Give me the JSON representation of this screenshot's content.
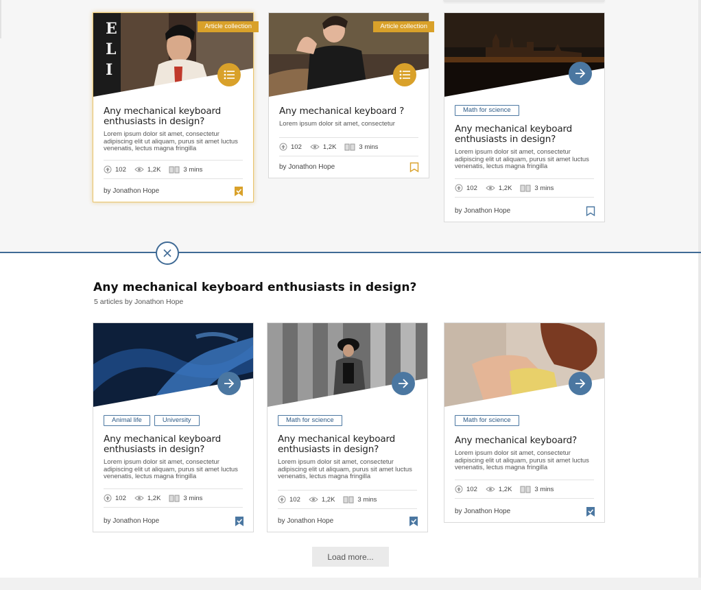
{
  "top_cards": [
    {
      "ribbon": "Article collection",
      "title": "Any mechanical keyboard enthusiasts in design?",
      "desc": "Lorem ipsum dolor sit amet, consectetur adipiscing elit ut aliquam, purus sit amet luctus venenatis, lectus magna fringilla",
      "upvotes": "102",
      "views": "1,2K",
      "read": "3 mins",
      "author": "by Jonathon Hope"
    },
    {
      "ribbon": "Article collection",
      "title": "Any mechanical keyboard ?",
      "desc": "Lorem ipsum dolor sit amet, consectetur",
      "upvotes": "102",
      "views": "1,2K",
      "read": "3 mins",
      "author": "by Jonathon Hope"
    },
    {
      "tag": "Math for science",
      "title": "Any mechanical keyboard enthusiasts in design?",
      "desc": "Lorem ipsum dolor sit amet, consectetur adipiscing elit ut aliquam, purus sit amet luctus venenatis, lectus magna fringilla",
      "upvotes": "102",
      "views": "1,2K",
      "read": "3 mins",
      "author": "by Jonathon Hope"
    }
  ],
  "collection": {
    "title": "Any mechanical keyboard enthusiasts in design?",
    "subtitle": "5 articles by Jonathon Hope",
    "load_more": "Load more..."
  },
  "bottom_cards": [
    {
      "tags": [
        "Animal life",
        "University"
      ],
      "title": "Any mechanical keyboard enthusiasts in design?",
      "desc": "Lorem ipsum dolor sit amet, consectetur adipiscing elit ut aliquam, purus sit amet luctus venenatis, lectus magna fringilla",
      "upvotes": "102",
      "views": "1,2K",
      "read": "3 mins",
      "author": "by Jonathon Hope"
    },
    {
      "tags": [
        "Math for science"
      ],
      "title": "Any mechanical keyboard enthusiasts in design?",
      "desc": "Lorem ipsum dolor sit amet, consectetur adipiscing elit ut aliquam, purus sit amet luctus venenatis, lectus magna fringilla",
      "upvotes": "102",
      "views": "1,2K",
      "read": "3 mins",
      "author": "by Jonathon Hope"
    },
    {
      "tags": [
        "Math for science"
      ],
      "title": "Any mechanical keyboard?",
      "desc": "Lorem ipsum dolor sit amet, consectetur adipiscing elit ut aliquam, purus sit amet luctus venenatis, lectus magna fringilla",
      "upvotes": "102",
      "views": "1,2K",
      "read": "3 mins",
      "author": "by Jonathon Hope"
    }
  ],
  "colors": {
    "gold": "#d9a12a",
    "blue": "#4b77a1",
    "divider": "#3f6a95"
  },
  "icons": {
    "list": "list-icon",
    "arrow": "arrow-right-icon",
    "close": "close-icon",
    "bookmark": "bookmark-icon",
    "upvote": "upvote-icon",
    "views": "eye-icon",
    "read": "book-icon"
  }
}
